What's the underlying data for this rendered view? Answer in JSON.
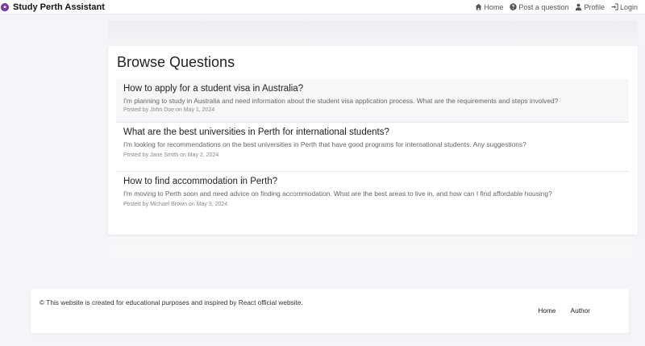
{
  "navbar": {
    "brand": "Study Perth Assistant",
    "links": [
      {
        "label": "Home",
        "icon": "home-icon"
      },
      {
        "label": "Post a question",
        "icon": "question-circle-icon"
      },
      {
        "label": "Profile",
        "icon": "user-icon"
      },
      {
        "label": "Login",
        "icon": "login-icon"
      }
    ]
  },
  "main": {
    "title": "Browse Questions",
    "questions": [
      {
        "title": "How to apply for a student visa in Australia?",
        "body": "I'm planning to study in Australia and need information about the student visa application process. What are the requirements and steps involved?",
        "meta": "Posted by John Doe on May 1, 2024"
      },
      {
        "title": "What are the best universities in Perth for international students?",
        "body": "I'm looking for recommendations on the best universities in Perth that have good programs for international students. Any suggestions?",
        "meta": "Posted by Jane Smith on May 2, 2024"
      },
      {
        "title": "How to find accommodation in Perth?",
        "body": "I'm moving to Perth soon and need advice on finding accommodation. What are the best areas to live in, and how can I find affordable housing?",
        "meta": "Posted by Michael Brown on May 3, 2024"
      }
    ]
  },
  "footer": {
    "text": "© This website is created for educational purposes and inspired by React official website.",
    "links": [
      "Home",
      "Author"
    ]
  },
  "colors": {
    "background": "#f3f5f8",
    "card": "#ffffff",
    "brand_logo": "#7b3fb4"
  }
}
